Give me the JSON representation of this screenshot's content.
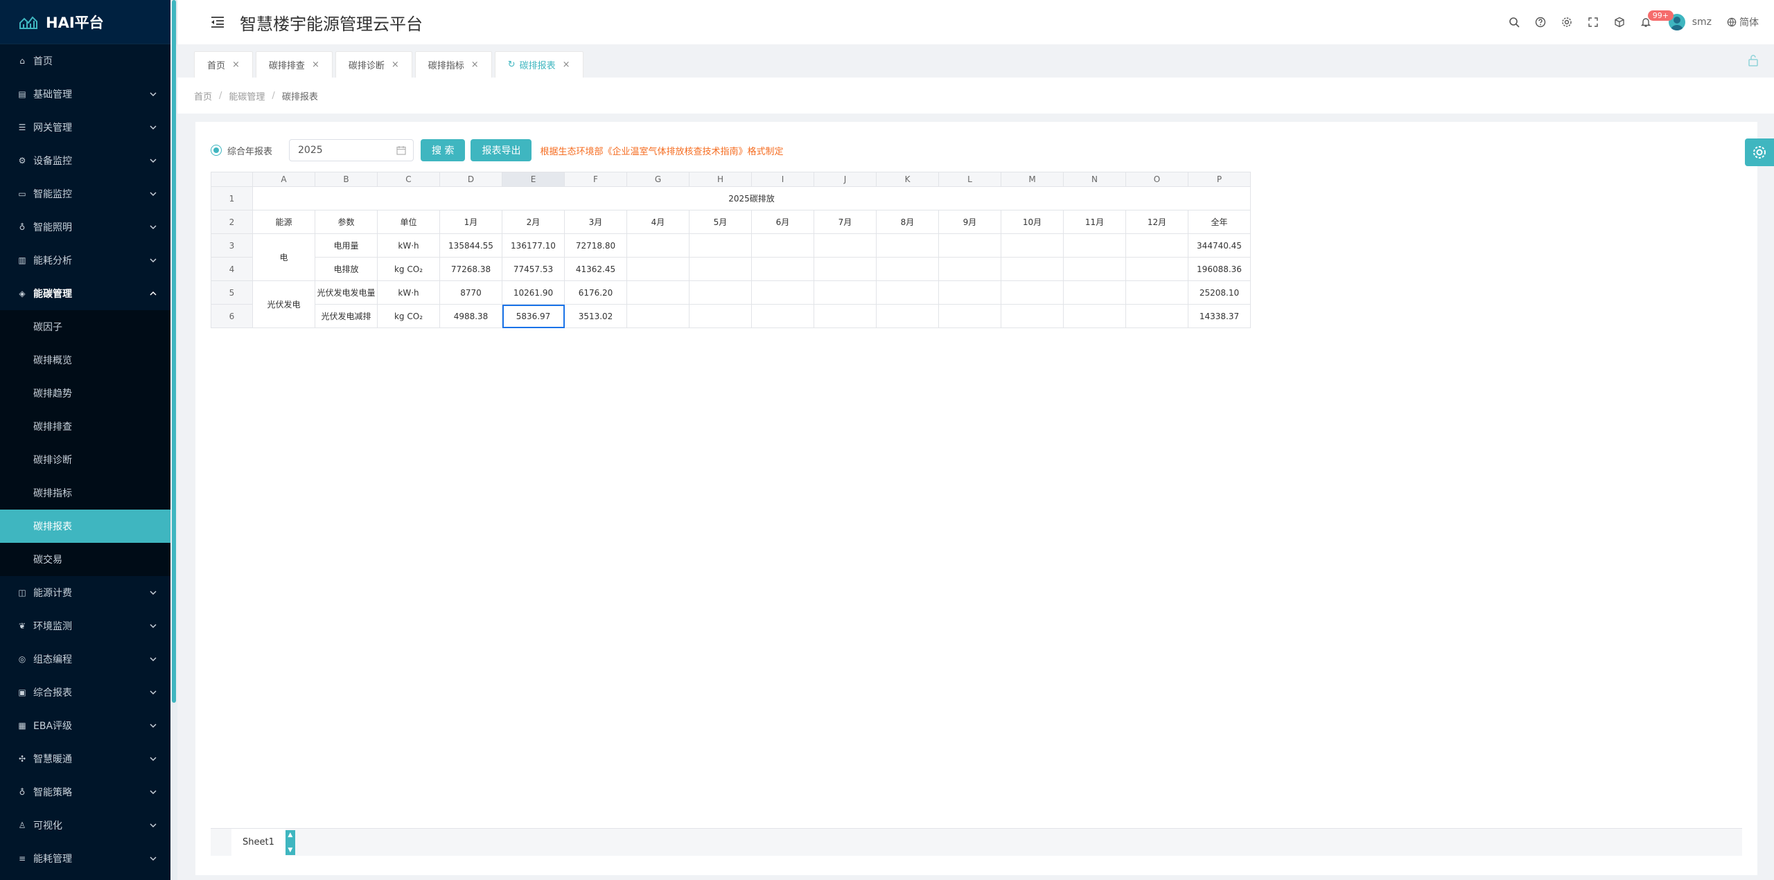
{
  "brand": {
    "name": "HAI平台"
  },
  "header": {
    "title": "智慧楼宇能源管理云平台",
    "badge": "99+",
    "user": "smz",
    "language": "简体"
  },
  "sidebar": {
    "items": [
      {
        "label": "首页",
        "icon": "home-icon"
      },
      {
        "label": "基础管理",
        "icon": "database-icon"
      },
      {
        "label": "网关管理",
        "icon": "sliders-icon"
      },
      {
        "label": "设备监控",
        "icon": "gear-icon"
      },
      {
        "label": "智能监控",
        "icon": "monitor-icon"
      },
      {
        "label": "智能照明",
        "icon": "bulb-icon"
      },
      {
        "label": "能耗分析",
        "icon": "bar-chart-icon"
      },
      {
        "label": "能碳管理",
        "icon": "layers-icon"
      }
    ],
    "sub_items": [
      {
        "label": "碳因子"
      },
      {
        "label": "碳排概览"
      },
      {
        "label": "碳排趋势"
      },
      {
        "label": "碳排排查"
      },
      {
        "label": "碳排诊断"
      },
      {
        "label": "碳排指标"
      },
      {
        "label": "碳排报表"
      },
      {
        "label": "碳交易"
      }
    ],
    "items_after": [
      {
        "label": "能源计费",
        "icon": "money-icon"
      },
      {
        "label": "环境监测",
        "icon": "leaf-icon"
      },
      {
        "label": "组态编程",
        "icon": "target-icon"
      },
      {
        "label": "综合报表",
        "icon": "report-icon"
      },
      {
        "label": "EBA评级",
        "icon": "grade-icon"
      },
      {
        "label": "智慧暖通",
        "icon": "fan-icon"
      },
      {
        "label": "智能策略",
        "icon": "strategy-icon"
      },
      {
        "label": "可视化",
        "icon": "user-icon"
      },
      {
        "label": "能耗管理",
        "icon": "list-icon"
      }
    ]
  },
  "tabs": [
    {
      "label": "首页"
    },
    {
      "label": "碳排排查"
    },
    {
      "label": "碳排诊断"
    },
    {
      "label": "碳排指标"
    },
    {
      "label": "碳排报表"
    }
  ],
  "breadcrumb": [
    "首页",
    "能碳管理",
    "碳排报表"
  ],
  "toolbar": {
    "radio_label": "综合年报表",
    "year": "2025",
    "search_label": "搜 索",
    "export_label": "报表导出",
    "note": "根据生态环境部《企业温室气体排放核查技术指南》格式制定"
  },
  "sheet": {
    "col_headers": [
      "A",
      "B",
      "C",
      "D",
      "E",
      "F",
      "G",
      "H",
      "I",
      "J",
      "K",
      "L",
      "M",
      "N",
      "O",
      "P"
    ],
    "row_headers": [
      "1",
      "2",
      "3",
      "4",
      "5",
      "6"
    ],
    "title": "2025碳排放",
    "header_row": [
      "能源",
      "参数",
      "单位",
      "1月",
      "2月",
      "3月",
      "4月",
      "5月",
      "6月",
      "7月",
      "8月",
      "9月",
      "10月",
      "11月",
      "12月",
      "全年"
    ],
    "groups": [
      {
        "source": "电",
        "rows": [
          {
            "param": "电用量",
            "unit": "kW·h",
            "months": [
              "135844.55",
              "136177.10",
              "72718.80",
              "",
              "",
              "",
              "",
              "",
              "",
              "",
              "",
              ""
            ],
            "total": "344740.45"
          },
          {
            "param": "电排放",
            "unit": "kg CO₂",
            "months": [
              "77268.38",
              "77457.53",
              "41362.45",
              "",
              "",
              "",
              "",
              "",
              "",
              "",
              "",
              ""
            ],
            "total": "196088.36"
          }
        ]
      },
      {
        "source": "光伏发电",
        "rows": [
          {
            "param": "光伏发电发电量",
            "unit": "kW·h",
            "months": [
              "8770",
              "10261.90",
              "6176.20",
              "",
              "",
              "",
              "",
              "",
              "",
              "",
              "",
              ""
            ],
            "total": "25208.10"
          },
          {
            "param": "光伏发电减排",
            "unit": "kg CO₂",
            "months": [
              "4988.38",
              "5836.97",
              "3513.02",
              "",
              "",
              "",
              "",
              "",
              "",
              "",
              "",
              ""
            ],
            "total": "14338.37"
          }
        ]
      }
    ],
    "selected_cell": "E6",
    "sheet_name": "Sheet1"
  },
  "colors": {
    "accent": "#3fb6c0",
    "sidebar": "#001529",
    "note": "#f56c20"
  }
}
